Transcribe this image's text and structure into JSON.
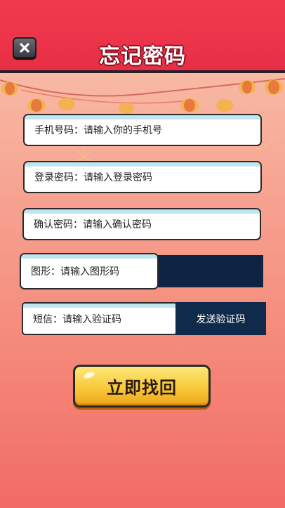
{
  "header": {
    "title": "忘记密码"
  },
  "form": {
    "phone": {
      "label": "手机号码",
      "placeholder": "请输入你的手机号"
    },
    "password": {
      "label": "登录密码",
      "placeholder": "请输入登录密码"
    },
    "confirm": {
      "label": "确认密码",
      "placeholder": "请输入确认密码"
    },
    "captcha": {
      "label": "图形",
      "placeholder": "请输入图形码"
    },
    "sms": {
      "label": "短信",
      "placeholder": "请输入验证码",
      "send_label": "发送验证码"
    }
  },
  "actions": {
    "submit_label": "立即找回"
  },
  "icons": {
    "close": "close-icon"
  },
  "colors": {
    "header": "#e72e45",
    "send_button": "#0f2a4a",
    "submit": "#f8c93b"
  }
}
